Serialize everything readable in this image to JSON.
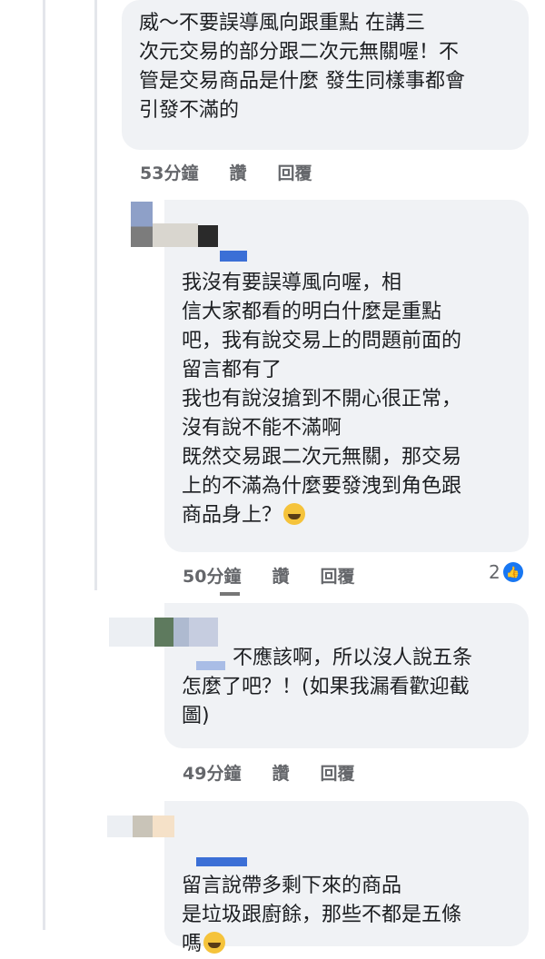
{
  "comments": [
    {
      "text": "威～不要誤導風向跟重點 在講三\n次元交易的部分跟二次元無關喔！不\n管是交易商品是什麼 發生同樣事都會\n引發不滿的",
      "time": "53分鐘",
      "like_label": "讚",
      "reply_label": "回覆"
    },
    {
      "text": "我沒有要誤導風向喔，相\n信大家都看的明白什麼是重點\n吧，我有說交易上的問題前面的\n留言都有了\n我也有說沒搶到不開心很正常，\n沒有說不能不滿啊\n既然交易跟二次元無關，那交易\n上的不滿為什麼要發洩到角色跟\n商品身上？",
      "emoji": "rofl-emoji",
      "time": "50分鐘",
      "like_label": "讚",
      "reply_label": "回覆",
      "reaction_count": "2",
      "reaction_icon": "like-icon"
    },
    {
      "text": "不應該啊，所以沒人說五条\n怎麼了吧？！(如果我漏看歡迎截\n圖)",
      "time": "49分鐘",
      "like_label": "讚",
      "reply_label": "回覆"
    },
    {
      "text": "留言說帶多剩下來的商品\n是垃圾跟廚餘，那些不都是五條\n嗎",
      "emoji": "rofl-emoji"
    }
  ],
  "colors": {
    "bubble": "#f0f2f5",
    "meta": "#65676b",
    "like_blue": "#1877f2"
  }
}
